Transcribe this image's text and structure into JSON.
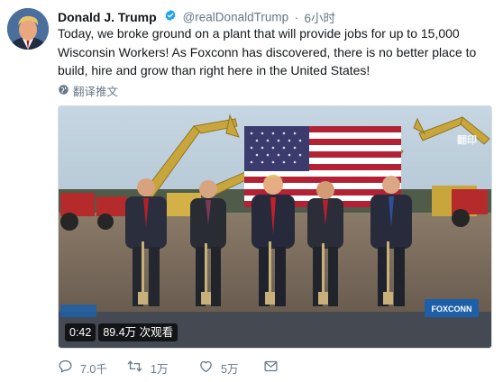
{
  "author": {
    "display_name": "Donald J. Trump",
    "handle": "@realDonaldTrump",
    "separator": "·",
    "time": "6小时"
  },
  "tweet": {
    "text": "Today, we broke ground on a plant that will provide jobs for up to 15,000 Wisconsin Workers! As Foxconn has discovered, there is no better place to build, hire and grow than right here in the United States!",
    "translate_label": "翻译推文"
  },
  "media": {
    "duration": "0:42",
    "views": "89.4万 次观看",
    "watermark": "翻印",
    "sign_text": "FOXCONN"
  },
  "actions": {
    "reply_count": "7.0千",
    "retweet_count": "1万",
    "like_count": "5万"
  },
  "icons": {
    "verified": "verified-badge-icon",
    "translate": "globe-icon",
    "reply": "reply-icon",
    "retweet": "retweet-icon",
    "like": "heart-icon",
    "message": "envelope-icon"
  },
  "colors": {
    "verified_blue": "#1da1f2",
    "secondary_text": "#657786"
  }
}
